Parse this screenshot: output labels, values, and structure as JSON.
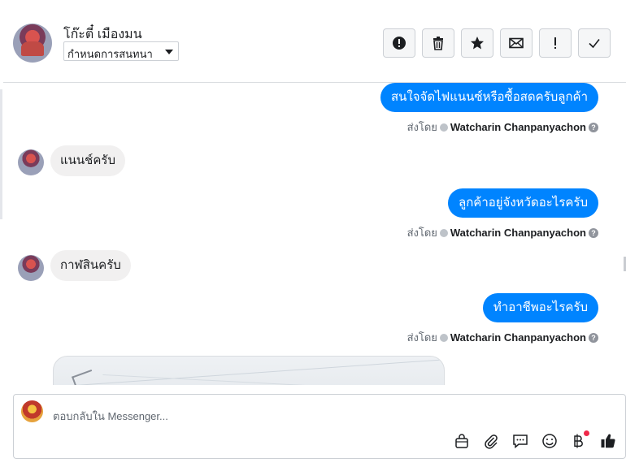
{
  "header": {
    "contact_name": "โก๊ะตี๋ เมืองมน",
    "status_select": "กำหนดการสนทนา",
    "toolbar": [
      {
        "name": "spam-button",
        "icon": "alert-circle-icon"
      },
      {
        "name": "delete-button",
        "icon": "trash-icon"
      },
      {
        "name": "star-button",
        "icon": "star-icon"
      },
      {
        "name": "unread-button",
        "icon": "envelope-icon"
      },
      {
        "name": "priority-button",
        "icon": "exclamation-icon"
      },
      {
        "name": "done-button",
        "icon": "check-icon"
      }
    ]
  },
  "messages": {
    "m1": {
      "direction": "out",
      "text": "สนใจจัดไฟแนนซ์หรือซื้อสดครับลูกค้า"
    },
    "m1_sent_by_prefix": "ส่งโดย",
    "m1_sender": "Watcharin Chanpanyachon",
    "m2": {
      "direction": "in",
      "text": "แนนช์ครับ"
    },
    "m3": {
      "direction": "out",
      "text": "ลูกค้าอยู่จังหวัดอะไรครับ"
    },
    "m3_sent_by_prefix": "ส่งโดย",
    "m3_sender": "Watcharin Chanpanyachon",
    "m4": {
      "direction": "in",
      "text": "กาฬสินครับ"
    },
    "m5": {
      "direction": "out",
      "text": "ทำอาชีพอะไรครับ"
    },
    "m5_sent_by_prefix": "ส่งโดย",
    "m5_sender": "Watcharin Chanpanyachon"
  },
  "composer": {
    "placeholder": "ตอบกลับใน Messenger...",
    "tools": [
      "shopping-bag-icon",
      "paperclip-icon",
      "chat-bubble-icon",
      "smiley-icon",
      "baht-icon",
      "thumbs-up-icon"
    ]
  },
  "colors": {
    "accent": "#0084ff",
    "incoming_bubble": "#f1f0f0",
    "notification_dot": "#f02849"
  }
}
